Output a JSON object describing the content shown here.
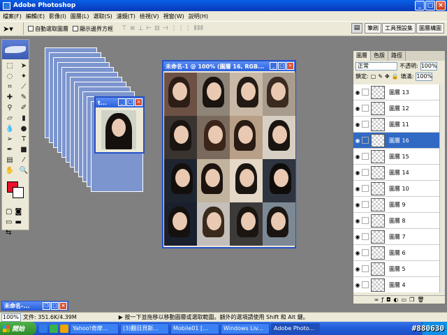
{
  "app": {
    "title": "Adobe Photoshop"
  },
  "menu": [
    "檔案(F)",
    "編輯(E)",
    "影像(I)",
    "圖層(L)",
    "選取(S)",
    "濾鏡(T)",
    "檢視(V)",
    "視窗(W)",
    "說明(H)"
  ],
  "options": {
    "auto_select_label": "自動選取圖層",
    "show_bounds_label": "顯示邊界方框",
    "dock_tabs": [
      "筆刷",
      "工具預設集",
      "圖層構圖"
    ]
  },
  "documents": {
    "main_title": "未命名-1 @ 100% (圖層 16, RGB...",
    "small_title": "t...",
    "minimized_title": "未命名-..."
  },
  "layers_panel": {
    "tabs": [
      "圖層",
      "色版",
      "路徑"
    ],
    "blend_mode": "正常",
    "opacity_label": "不透明:",
    "opacity_value": "100%",
    "lock_label": "鎖定:",
    "fill_label": "填滿:",
    "fill_value": "100%",
    "layers": [
      {
        "name": "圖層 13",
        "selected": false
      },
      {
        "name": "圖層 12",
        "selected": false
      },
      {
        "name": "圖層 11",
        "selected": false
      },
      {
        "name": "圖層 16",
        "selected": true
      },
      {
        "name": "圖層 15",
        "selected": false
      },
      {
        "name": "圖層 14",
        "selected": false
      },
      {
        "name": "圖層 10",
        "selected": false
      },
      {
        "name": "圖層 9",
        "selected": false
      },
      {
        "name": "圖層 8",
        "selected": false
      },
      {
        "name": "圖層 7",
        "selected": false
      },
      {
        "name": "圖層 6",
        "selected": false
      },
      {
        "name": "圖層 5",
        "selected": false
      },
      {
        "name": "圖層 4",
        "selected": false
      }
    ]
  },
  "status": {
    "zoom": "100%",
    "doc_size": "文件: 351.6K/4.39M",
    "hint": "按一下並拖移以移動圖層或選取範圍。額外的選項請使用 Shift 和 Alt 鍵。"
  },
  "taskbar": {
    "start_label": "開始",
    "buttons": [
      "Yahoo!奇摩...",
      "(3)翻日貝斯...",
      "Mobile01 [...",
      "Windows Liv...",
      "Adobe Photo..."
    ],
    "active_index": 4
  },
  "watermark": "#880630",
  "colors": {
    "foreground": "#e8102b",
    "background": "#ffffff",
    "accent": "#2652c8"
  }
}
